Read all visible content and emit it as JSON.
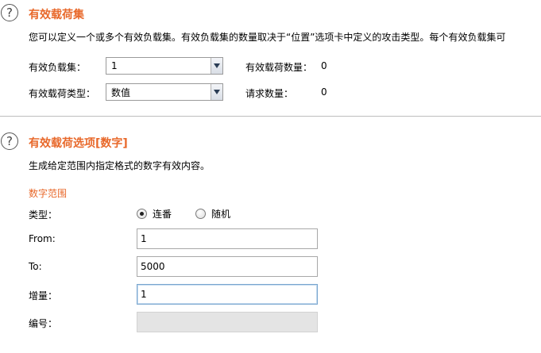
{
  "payload_sets": {
    "title": "有效载荷集",
    "description": "您可以定义一个或多个有效负载集。有效负载集的数量取决于“位置”选项卡中定义的攻击类型。每个有效负载集可",
    "payload_set_label": "有效负载集：",
    "payload_set_value": "1",
    "payload_type_label": "有效载荷类型：",
    "payload_type_value": "数值",
    "payload_count_label": "有效载荷数量：",
    "payload_count_value": "0",
    "request_count_label": "请求数量：",
    "request_count_value": "0"
  },
  "payload_options": {
    "title": "有效载荷选项[数字]",
    "description": "生成给定范围内指定格式的数字有效内容。",
    "range_heading": "数字范围",
    "type_label": "类型：",
    "type_options": [
      {
        "label": "连番",
        "selected": true
      },
      {
        "label": "随机",
        "selected": false
      }
    ],
    "from_label": "From:",
    "from_value": "1",
    "to_label": "To:",
    "to_value": "5000",
    "step_label": "增量：",
    "step_value": "1",
    "number_label": "编号：",
    "number_value": ""
  },
  "icons": {
    "help": "help-circle-icon",
    "dropdown": "chevron-down-icon"
  },
  "colors": {
    "accent": "#e8682a",
    "focus_border": "#7aa6cf",
    "disabled_fill": "#e4e4e4"
  }
}
